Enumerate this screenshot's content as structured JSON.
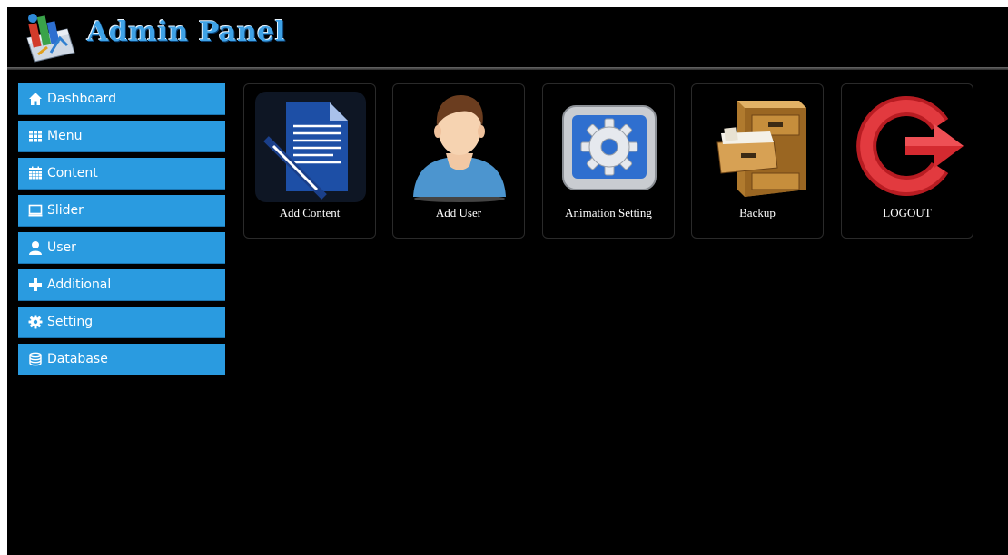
{
  "header": {
    "title": "Admin Panel",
    "logo_icon": "chart-logo-icon",
    "title_color": "#3fa2e6"
  },
  "sidebar": {
    "accent": "#2a9be0",
    "items": [
      {
        "label": "Dashboard",
        "icon": "home-icon"
      },
      {
        "label": "Menu",
        "icon": "grid-icon"
      },
      {
        "label": "Content",
        "icon": "calendar-icon"
      },
      {
        "label": "Slider",
        "icon": "monitor-icon"
      },
      {
        "label": "User",
        "icon": "user-icon"
      },
      {
        "label": "Additional",
        "icon": "plus-icon"
      },
      {
        "label": "Setting",
        "icon": "gear-icon"
      },
      {
        "label": "Database",
        "icon": "database-icon"
      }
    ]
  },
  "tiles": [
    {
      "label": "Add Content",
      "icon": "document-pen-icon"
    },
    {
      "label": "Add User",
      "icon": "person-avatar-icon"
    },
    {
      "label": "Animation Setting",
      "icon": "gear-app-icon"
    },
    {
      "label": "Backup",
      "icon": "filing-cabinet-icon"
    },
    {
      "label": "LOGOUT",
      "icon": "logout-arrow-icon"
    }
  ]
}
